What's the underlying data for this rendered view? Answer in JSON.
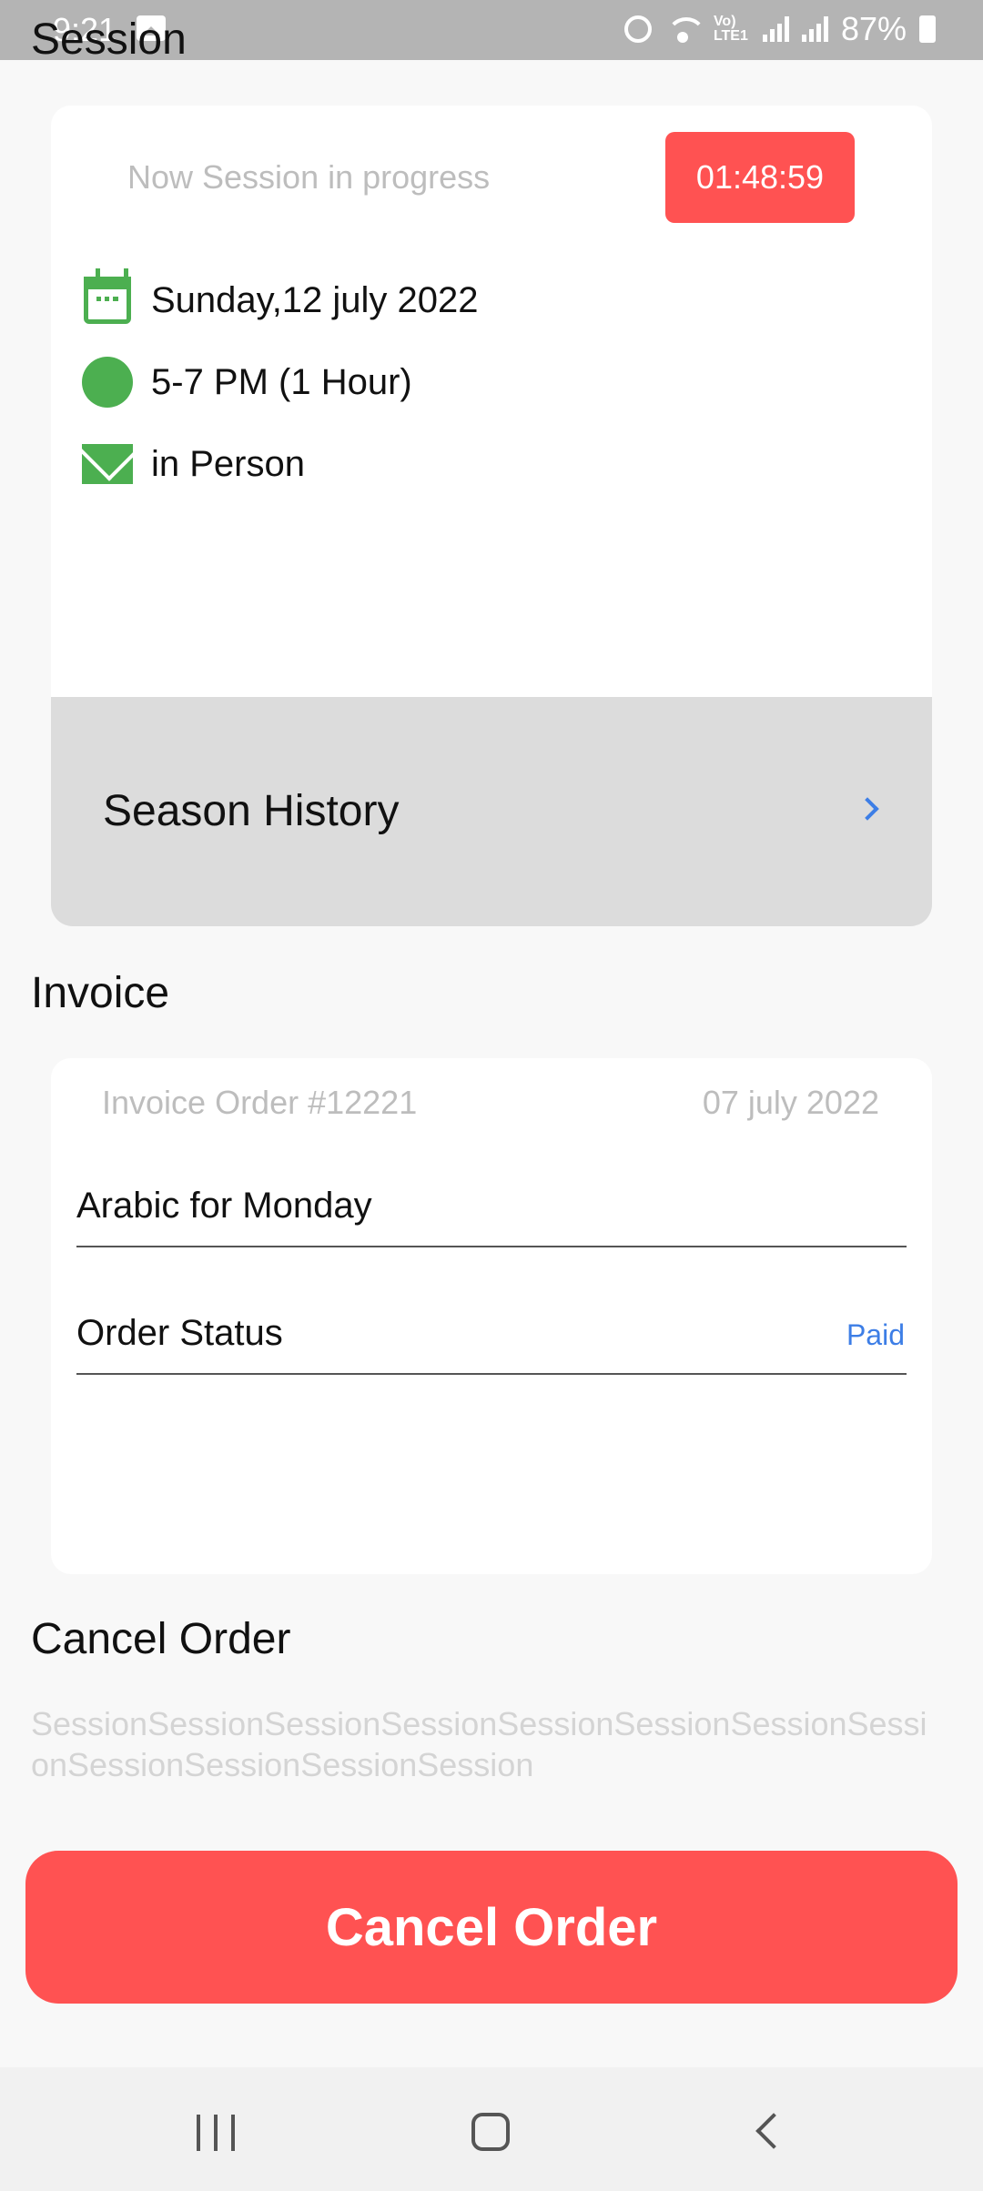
{
  "status_bar": {
    "time": "9:21",
    "lte_label": "Vo) LTE1",
    "battery": "87%"
  },
  "session": {
    "title": "Session",
    "status_text": "Now Session in progress",
    "timer": "01:48:59",
    "date": "Sunday,12 july 2022",
    "time_range": "5-7 PM (1 Hour)",
    "mode": "in Person",
    "icons": [
      "calendar-icon",
      "clock-icon",
      "mail-icon"
    ]
  },
  "history": {
    "label": "Season History"
  },
  "invoice": {
    "title": "Invoice",
    "order_no": "Invoice Order #12221",
    "order_date": "07 july 2022",
    "course": "Arabic for Monday",
    "status_label": "Order Status",
    "status_value": "Paid"
  },
  "cancel": {
    "title": "Cancel Order",
    "description": "SessionSessionSessionSessionSessionSessionSessionSessionSessionSessionSessionSession",
    "button_label": "Cancel Order"
  },
  "colors": {
    "accent_red": "#ff5252",
    "green": "#4caf50",
    "link_blue": "#3d7ee6"
  }
}
